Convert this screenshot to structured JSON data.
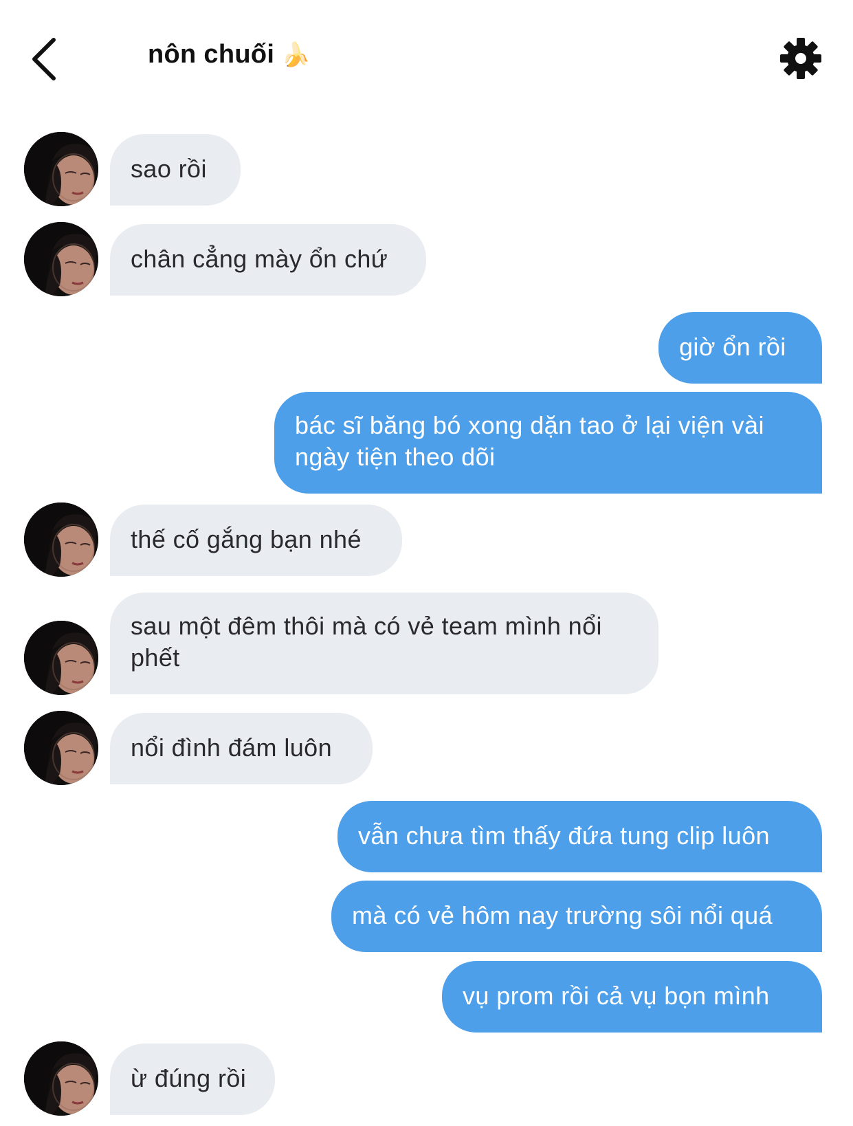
{
  "header": {
    "title": "nôn chuối",
    "title_emoji": "🍌",
    "back_icon": "chevron-left-icon",
    "settings_icon": "gear-icon"
  },
  "colors": {
    "incoming_bubble": "#e9ecf1",
    "outgoing_bubble": "#4d9fea",
    "background": "#ffffff"
  },
  "messages": [
    {
      "direction": "incoming",
      "text": "sao rồi"
    },
    {
      "direction": "incoming",
      "text": "chân cẳng mày ổn chứ"
    },
    {
      "direction": "outgoing",
      "text": "giờ ổn rồi"
    },
    {
      "direction": "outgoing",
      "text": "bác sĩ băng bó xong dặn tao ở lại viện vài ngày tiện theo dõi"
    },
    {
      "direction": "incoming",
      "text": "thế cố gắng bạn nhé"
    },
    {
      "direction": "incoming",
      "text": "sau một đêm thôi mà có vẻ team mình nổi phết"
    },
    {
      "direction": "incoming",
      "text": "nổi đình đám luôn"
    },
    {
      "direction": "outgoing",
      "text": "vẫn chưa tìm thấy đứa tung clip luôn"
    },
    {
      "direction": "outgoing",
      "text": "mà có vẻ hôm nay trường sôi nổi quá"
    },
    {
      "direction": "outgoing",
      "text": "vụ prom rồi cả vụ bọn mình"
    },
    {
      "direction": "incoming",
      "text": "ừ đúng rồi"
    }
  ]
}
